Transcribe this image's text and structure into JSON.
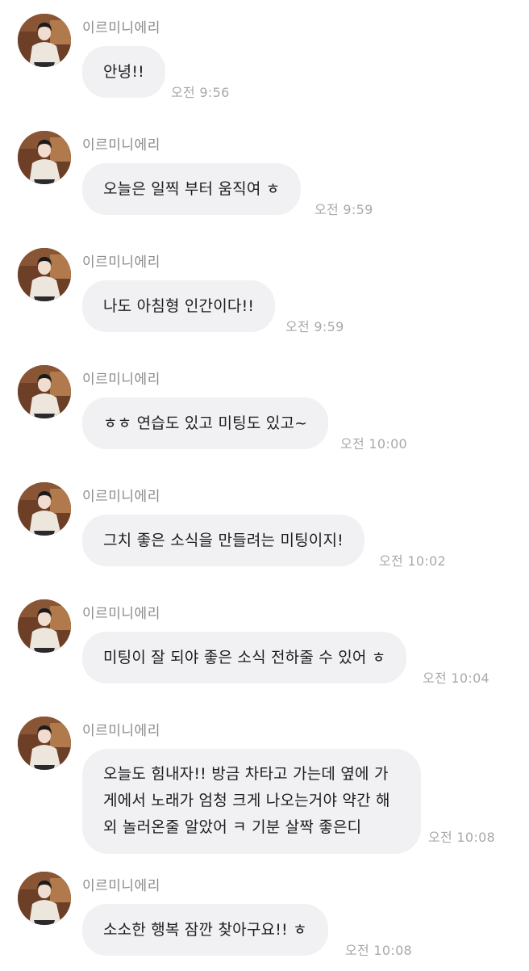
{
  "sender_name": "이르미니에리",
  "colors": {
    "bubble": "#f1f1f3",
    "sender": "#8b8b8b",
    "time": "#a9a9a9",
    "text": "#1c1c1c"
  },
  "messages": [
    {
      "text": "안녕!!",
      "time": "오전 9:56"
    },
    {
      "text": "오늘은 일찍 부터 움직여 ㅎ",
      "time": "오전 9:59"
    },
    {
      "text": "나도 아침형 인간이다!!",
      "time": "오전 9:59"
    },
    {
      "text": "ㅎㅎ 연습도 있고 미팅도 있고~",
      "time": "오전 10:00"
    },
    {
      "text": "그치 좋은 소식을 만들려는 미팅이지!",
      "time": "오전 10:02"
    },
    {
      "text": "미팅이 잘 되야 좋은 소식 전하줄 수 있어 ㅎ",
      "time": "오전 10:04"
    },
    {
      "text": "오늘도 힘내자!! 방금 차타고 가는데 옆에 가게에서 노래가 엄청 크게 나오는거야 약간 해외 놀러온줄 알았어 ㅋ 기분 살짝 좋은디",
      "time": "오전 10:08"
    },
    {
      "text": "소소한 행복 잠깐 찾아구요!! ㅎ",
      "time": "오전 10:08"
    }
  ]
}
